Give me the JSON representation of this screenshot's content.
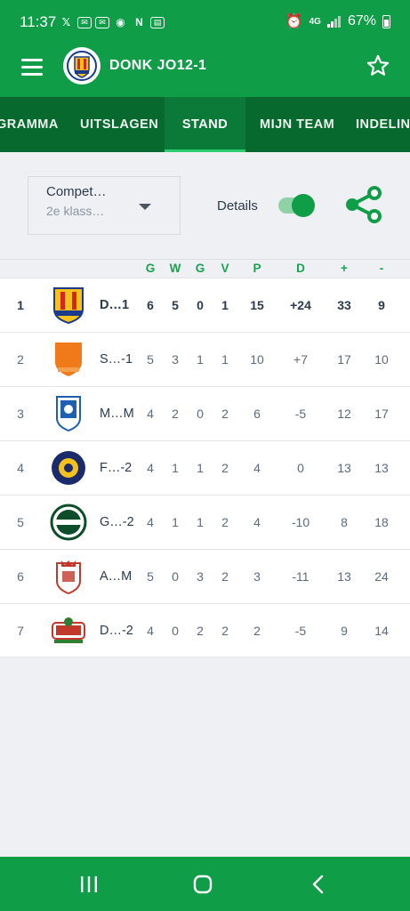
{
  "status_bar": {
    "time": "11:37",
    "network": "4G",
    "battery": "67%"
  },
  "app_bar": {
    "title": "DONK JO12-1"
  },
  "tabs": [
    {
      "label": "GRAMMA"
    },
    {
      "label": "UITSLAGEN"
    },
    {
      "label": "STAND",
      "active": true
    },
    {
      "label": "MIJN TEAM"
    },
    {
      "label": "INDELING"
    }
  ],
  "competition": {
    "title": "Compet…",
    "subtitle": "2e klass…"
  },
  "details": {
    "label": "Details",
    "enabled": true
  },
  "table": {
    "headers": [
      "G",
      "W",
      "G",
      "V",
      "P",
      "D",
      "+",
      "-"
    ],
    "rows": [
      {
        "pos": "1",
        "team": "D…1",
        "g": "6",
        "w": "5",
        "gl": "0",
        "v": "1",
        "p": "15",
        "d": "+24",
        "plus": "33",
        "minus": "9",
        "highlight": true
      },
      {
        "pos": "2",
        "team": "S…-1",
        "g": "5",
        "w": "3",
        "gl": "1",
        "v": "1",
        "p": "10",
        "d": "+7",
        "plus": "17",
        "minus": "10"
      },
      {
        "pos": "3",
        "team": "M…M",
        "g": "4",
        "w": "2",
        "gl": "0",
        "v": "2",
        "p": "6",
        "d": "-5",
        "plus": "12",
        "minus": "17"
      },
      {
        "pos": "4",
        "team": "F…-2",
        "g": "4",
        "w": "1",
        "gl": "1",
        "v": "2",
        "p": "4",
        "d": "0",
        "plus": "13",
        "minus": "13"
      },
      {
        "pos": "5",
        "team": "G…-2",
        "g": "4",
        "w": "1",
        "gl": "1",
        "v": "2",
        "p": "4",
        "d": "-10",
        "plus": "8",
        "minus": "18"
      },
      {
        "pos": "6",
        "team": "A…M",
        "g": "5",
        "w": "0",
        "gl": "3",
        "v": "2",
        "p": "3",
        "d": "-11",
        "plus": "13",
        "minus": "24"
      },
      {
        "pos": "7",
        "team": "D…-2",
        "g": "4",
        "w": "0",
        "gl": "2",
        "v": "2",
        "p": "2",
        "d": "-5",
        "plus": "9",
        "minus": "14"
      }
    ]
  },
  "colors": {
    "primary": "#0f9d48",
    "tab_bar": "#08692f",
    "accent": "#19a350",
    "background": "#eef0f3"
  }
}
